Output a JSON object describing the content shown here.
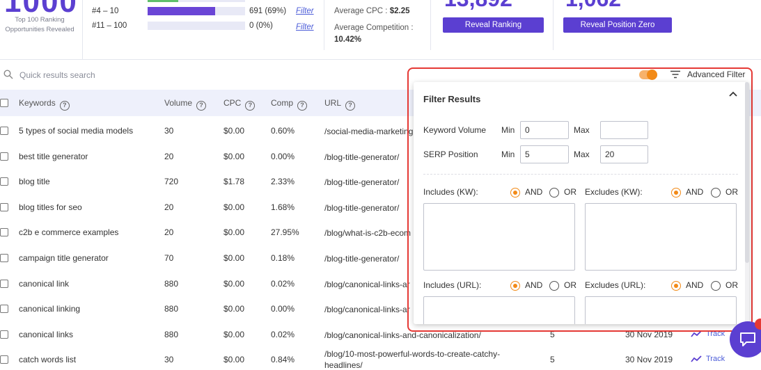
{
  "summary": {
    "big_number": "1000",
    "big_number_label": "Top 100 Ranking Opportunities Revealed",
    "ranges": [
      {
        "label": "#4 – 10",
        "count": "691 (69%)",
        "fill_percent": 69,
        "link": "Filter"
      },
      {
        "label": "#11 – 100",
        "count": "0 (0%)",
        "fill_percent": 0,
        "link": "Filter"
      }
    ],
    "avg_cpc_label": "Average CPC :",
    "avg_cpc_value": "$2.25",
    "avg_competition_label": "Average Competition :",
    "avg_competition_value": "10.42%",
    "ranking_number": "13,892",
    "position_zero_number": "1,062",
    "reveal_ranking_label": "Reveal Ranking",
    "reveal_position_zero_label": "Reveal Position Zero"
  },
  "search": {
    "placeholder": "Quick results search",
    "advanced_filter_label": "Advanced Filter",
    "toggle_on": true
  },
  "table": {
    "headers": {
      "keywords": "Keywords",
      "volume": "Volume",
      "cpc": "CPC",
      "comp": "Comp",
      "url": "URL"
    },
    "rows": [
      {
        "keyword": "5 types of social media models",
        "volume": "30",
        "cpc": "$0.00",
        "comp": "0.60%",
        "url": "/social-media-marketing",
        "pos": "",
        "date": "",
        "track": ""
      },
      {
        "keyword": "best title generator",
        "volume": "20",
        "cpc": "$0.00",
        "comp": "0.00%",
        "url": "/blog-title-generator/",
        "pos": "",
        "date": "",
        "track": ""
      },
      {
        "keyword": "blog title",
        "volume": "720",
        "cpc": "$1.78",
        "comp": "2.33%",
        "url": "/blog-title-generator/",
        "pos": "",
        "date": "",
        "track": ""
      },
      {
        "keyword": "blog titles for seo",
        "volume": "20",
        "cpc": "$0.00",
        "comp": "1.68%",
        "url": "/blog-title-generator/",
        "pos": "",
        "date": "",
        "track": ""
      },
      {
        "keyword": "c2b e commerce examples",
        "volume": "20",
        "cpc": "$0.00",
        "comp": "27.95%",
        "url": "/blog/what-is-c2b-ecom",
        "pos": "",
        "date": "",
        "track": ""
      },
      {
        "keyword": "campaign title generator",
        "volume": "70",
        "cpc": "$0.00",
        "comp": "0.18%",
        "url": "/blog-title-generator/",
        "pos": "",
        "date": "",
        "track": ""
      },
      {
        "keyword": "canonical link",
        "volume": "880",
        "cpc": "$0.00",
        "comp": "0.02%",
        "url": "/blog/canonical-links-ar",
        "pos": "",
        "date": "",
        "track": ""
      },
      {
        "keyword": "canonical linking",
        "volume": "880",
        "cpc": "$0.00",
        "comp": "0.00%",
        "url": "/blog/canonical-links-ar",
        "pos": "",
        "date": "",
        "track": ""
      },
      {
        "keyword": "canonical links",
        "volume": "880",
        "cpc": "$0.00",
        "comp": "0.02%",
        "url": "/blog/canonical-links-and-canonicalization/",
        "pos": "5",
        "date": "30 Nov 2019",
        "track": "Track"
      },
      {
        "keyword": "catch words list",
        "volume": "30",
        "cpc": "$0.00",
        "comp": "0.84%",
        "url": "/blog/10-most-powerful-words-to-create-catchy-headlines/",
        "pos": "5",
        "date": "30 Nov 2019",
        "track": "Track"
      }
    ]
  },
  "filter_panel": {
    "title": "Filter Results",
    "keyword_volume_label": "Keyword Volume",
    "serp_position_label": "SERP Position",
    "min_label": "Min",
    "max_label": "Max",
    "kv_min": "0",
    "kv_max": "",
    "serp_min": "5",
    "serp_max": "20",
    "includes_kw_label": "Includes (KW):",
    "excludes_kw_label": "Excludes (KW):",
    "includes_url_label": "Includes (URL):",
    "excludes_url_label": "Excludes (URL):",
    "and_label": "AND",
    "or_label": "OR",
    "selected_logic": "AND"
  },
  "colors": {
    "accent": "#5b3fd1",
    "toggle": "#f28a17",
    "highlight_outline": "#e53935",
    "link": "#4a5bd8"
  }
}
